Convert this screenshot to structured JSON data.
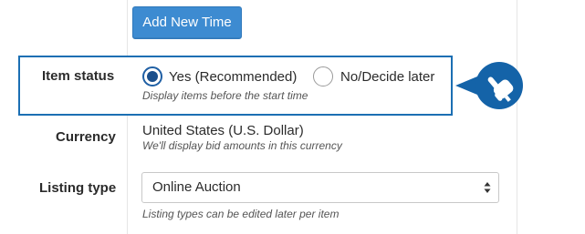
{
  "add_button": {
    "label": "Add New Time"
  },
  "item_status": {
    "label": "Item status",
    "options": [
      {
        "label": "Yes (Recommended)",
        "selected": true
      },
      {
        "label": "No/Decide later",
        "selected": false
      }
    ],
    "hint": "Display items before the start time"
  },
  "currency": {
    "label": "Currency",
    "value": "United States (U.S. Dollar)",
    "hint": "We'll display bid amounts in this currency"
  },
  "listing_type": {
    "label": "Listing type",
    "selected": "Online Auction",
    "hint": "Listing types can be edited later per item"
  },
  "callout": {
    "icon": "hand-pointer-icon",
    "color": "#1463a8"
  },
  "colors": {
    "accent": "#3d8bd1",
    "highlight_border": "#1b6fb3",
    "radio_fill": "#1a4f8c"
  }
}
